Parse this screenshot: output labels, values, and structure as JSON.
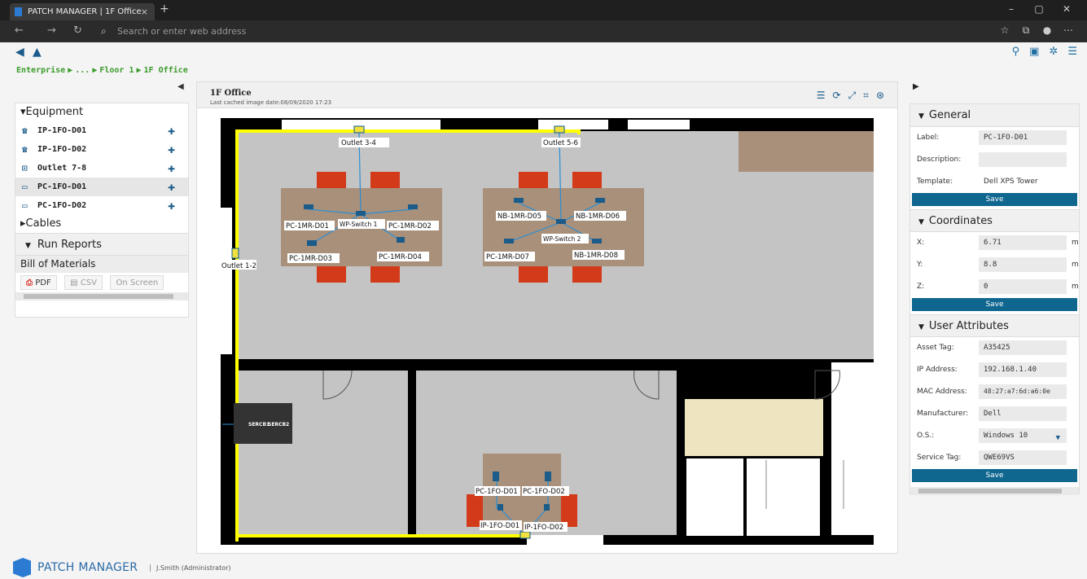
{
  "browser": {
    "tab_title": "PATCH MANAGER | 1F Office",
    "tab_close": "×",
    "new_tab": "+",
    "address_placeholder": "Search or enter web address",
    "window_controls": [
      "–",
      "▢",
      "✕"
    ]
  },
  "breadcrumb": [
    "Enterprise",
    "...",
    "Floor 1",
    "1F Office"
  ],
  "left_panel": {
    "equipment_header": "Equipment",
    "equipment": [
      {
        "label": "IP-1FO-D01",
        "icon": "phone-icon"
      },
      {
        "label": "IP-1FO-D02",
        "icon": "phone-icon"
      },
      {
        "label": "Outlet 7-8",
        "icon": "outlet-icon"
      },
      {
        "label": "PC-1FO-D01",
        "icon": "computer-icon",
        "selected": true
      },
      {
        "label": "PC-1FO-D02",
        "icon": "computer-icon"
      }
    ],
    "cables_header": "Cables",
    "reports_header": "Run Reports",
    "bom_header": "Bill of Materials",
    "export_buttons": [
      "PDF",
      "CSV",
      "On Screen"
    ]
  },
  "center": {
    "title": "1F Office",
    "cache_text": "Last cached image date:08/09/2020 17:23"
  },
  "floorplan": {
    "outlet_labels": [
      "Outlet 3-4",
      "Outlet 5-6",
      "Outlet 1-2"
    ],
    "device_labels_left": [
      "PC-1MR-D01",
      "WP-Switch 1",
      "PC-1MR-D02",
      "PC-1MR-D03",
      "PC-1MR-D04"
    ],
    "device_labels_right": [
      "NB-1MR-D05",
      "NB-1MR-D06",
      "WP-Switch 2",
      "PC-1MR-D07",
      "NB-1MR-D08"
    ],
    "rack_labels": [
      "SERCB1",
      "SERCB2"
    ],
    "bottom_labels": [
      "PC-1FO-D01",
      "PC-1FO-D02",
      "IP-1FO-D01",
      "IP-1FO-D02"
    ]
  },
  "right_panel": {
    "general_header": "General",
    "general": {
      "label_label": "Label:",
      "label_value": "PC-1FO-D01",
      "description_label": "Description:",
      "description_value": "",
      "template_label": "Template:",
      "template_value": "Dell XPS Tower"
    },
    "coordinates_header": "Coordinates",
    "coordinates": {
      "x_label": "X:",
      "x_value": "6.71",
      "y_label": "Y:",
      "y_value": "8.8",
      "z_label": "Z:",
      "z_value": "0",
      "unit": "m"
    },
    "user_attributes_header": "User Attributes",
    "user_attributes": {
      "asset_tag_label": "Asset Tag:",
      "asset_tag_value": "A35425",
      "ip_label": "IP Address:",
      "ip_value": "192.168.1.40",
      "mac_label": "MAC Address:",
      "mac_value": "48:27:a7:6d:a6:0e",
      "manufacturer_label": "Manufacturer:",
      "manufacturer_value": "Dell",
      "os_label": "O.S.:",
      "os_value": "Windows 10",
      "service_tag_label": "Service Tag:",
      "service_tag_value": "QWE69VS"
    },
    "save_label": "Save"
  },
  "footer": {
    "brand": "PATCH MANAGER",
    "user": "J.Smith (Administrator)"
  },
  "colors": {
    "accent": "#0f6790",
    "breadcrumb": "#3a9a2a",
    "cable": "#2a8fd6",
    "boundary": "#ffff00"
  }
}
